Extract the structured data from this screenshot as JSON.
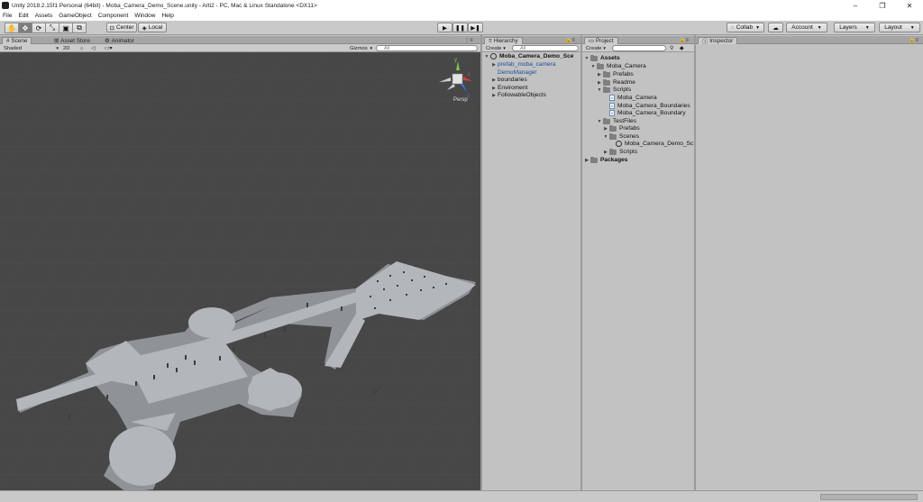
{
  "window": {
    "title": "Unity 2018.2.15f1 Personal (64bit) - Moba_Camera_Demo_Scene.unity - Arti2 - PC, Mac & Linux Standalone <DX11>",
    "controls": [
      "–",
      "❐",
      "✕"
    ]
  },
  "menu": [
    "File",
    "Edit",
    "Assets",
    "GameObject",
    "Component",
    "Window",
    "Help"
  ],
  "toolbar": {
    "tools": [
      "hand-icon",
      "move-icon",
      "rotate-icon",
      "scale-icon",
      "rect-icon",
      "transform-icon"
    ],
    "pivot_label": "Center",
    "space_label": "Local",
    "play": "▶",
    "pause": "❚❚",
    "step": "▶❚",
    "collab_label": "Collab",
    "account_label": "Account",
    "layers_label": "Layers",
    "layout_label": "Layout"
  },
  "scene_panel": {
    "tabs": [
      "Scene",
      "Asset Store",
      "Animator"
    ],
    "shading": "Shaded",
    "mode_2d": "2D",
    "gizmos": "Gizmos",
    "search_placeholder": "All",
    "gizmo_axes": {
      "y": "y",
      "x": "x",
      "z": "z"
    },
    "persp_label": "Persp"
  },
  "hierarchy": {
    "tab": "Hierarchy",
    "create_label": "Create",
    "search_placeholder": "All",
    "scene_name": "Moba_Camera_Demo_Sce",
    "items": [
      "prefab_moba_camera",
      "DemoManager",
      "boundaries",
      "Enviroment",
      "FollowableObjects"
    ]
  },
  "project": {
    "tab": "Project",
    "create_label": "Create",
    "tree": {
      "assets": "Assets",
      "moba_camera": "Moba_Camera",
      "prefabs": "Prefabs",
      "readme": "Readme",
      "scripts": "Scripts",
      "script_files": [
        "Moba_Camera",
        "Moba_Camera_Boundaries",
        "Moba_Camera_Boundary"
      ],
      "testfiles": "TestFiles",
      "test_prefabs": "Prefabs",
      "scenes": "Scenes",
      "scene_file": "Moba_Camera_Demo_Sc",
      "test_scripts": "Scripts",
      "packages": "Packages"
    }
  },
  "inspector": {
    "tab": "Inspector"
  },
  "colors": {
    "scene_bg": "#474747",
    "panel_bg": "#c2c2c2",
    "selection_text": "#1a4fa0",
    "level_gray": "#aeb1b5"
  }
}
